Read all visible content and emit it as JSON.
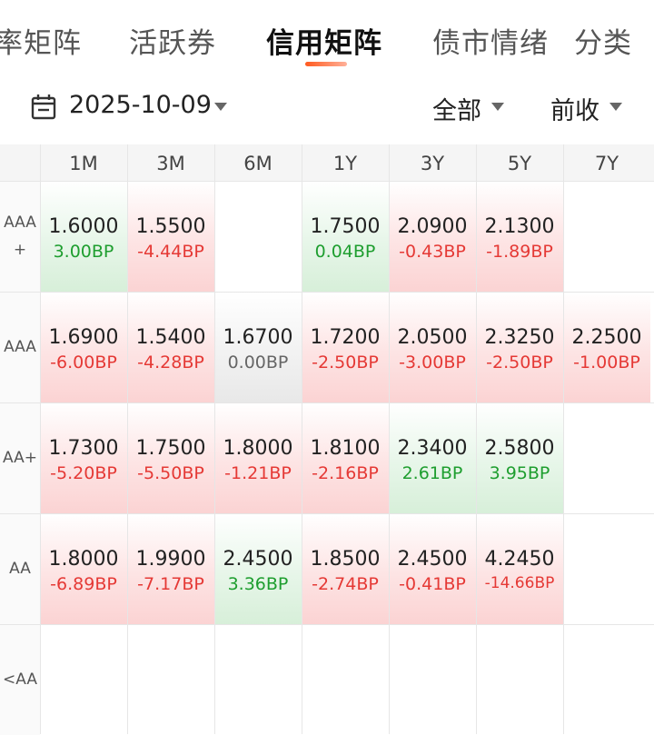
{
  "tabs": [
    {
      "label": "率矩阵"
    },
    {
      "label": "活跃券"
    },
    {
      "label": "信用矩阵"
    },
    {
      "label": "债市情绪"
    },
    {
      "label": "分类"
    }
  ],
  "filters": {
    "date": "2025-10-09",
    "scope": "全部",
    "price_basis": "前收"
  },
  "matrix": {
    "columns": [
      "1M",
      "3M",
      "6M",
      "1Y",
      "3Y",
      "5Y",
      "7Y"
    ],
    "rows": [
      {
        "label": "AAA\n+",
        "cells": [
          {
            "rate": "1.6000",
            "chg": "3.00BP",
            "dir": "down"
          },
          {
            "rate": "1.5500",
            "chg": "-4.44BP",
            "dir": "up"
          },
          null,
          {
            "rate": "1.7500",
            "chg": "0.04BP",
            "dir": "down"
          },
          {
            "rate": "2.0900",
            "chg": "-0.43BP",
            "dir": "up"
          },
          {
            "rate": "2.1300",
            "chg": "-1.89BP",
            "dir": "up"
          },
          null
        ]
      },
      {
        "label": "AAA",
        "cells": [
          {
            "rate": "1.6900",
            "chg": "-6.00BP",
            "dir": "up"
          },
          {
            "rate": "1.5400",
            "chg": "-4.28BP",
            "dir": "up"
          },
          {
            "rate": "1.6700",
            "chg": "0.00BP",
            "dir": "flat"
          },
          {
            "rate": "1.7200",
            "chg": "-2.50BP",
            "dir": "up"
          },
          {
            "rate": "2.0500",
            "chg": "-3.00BP",
            "dir": "up"
          },
          {
            "rate": "2.3250",
            "chg": "-2.50BP",
            "dir": "up"
          },
          {
            "rate": "2.2500",
            "chg": "-1.00BP",
            "dir": "up"
          }
        ]
      },
      {
        "label": "AA+",
        "cells": [
          {
            "rate": "1.7300",
            "chg": "-5.20BP",
            "dir": "up"
          },
          {
            "rate": "1.7500",
            "chg": "-5.50BP",
            "dir": "up"
          },
          {
            "rate": "1.8000",
            "chg": "-1.21BP",
            "dir": "up"
          },
          {
            "rate": "1.8100",
            "chg": "-2.16BP",
            "dir": "up"
          },
          {
            "rate": "2.3400",
            "chg": "2.61BP",
            "dir": "down"
          },
          {
            "rate": "2.5800",
            "chg": "3.95BP",
            "dir": "down"
          },
          null
        ]
      },
      {
        "label": "AA",
        "cells": [
          {
            "rate": "1.8000",
            "chg": "-6.89BP",
            "dir": "up"
          },
          {
            "rate": "1.9900",
            "chg": "-7.17BP",
            "dir": "up"
          },
          {
            "rate": "2.4500",
            "chg": "3.36BP",
            "dir": "down"
          },
          {
            "rate": "1.8500",
            "chg": "-2.74BP",
            "dir": "up"
          },
          {
            "rate": "2.4500",
            "chg": "-0.41BP",
            "dir": "up"
          },
          {
            "rate": "4.2450",
            "chg": "-14.66BP",
            "dir": "up"
          },
          null
        ]
      },
      {
        "label": "<AA",
        "cells": [
          null,
          null,
          null,
          null,
          null,
          null,
          null
        ]
      }
    ]
  },
  "colors": {
    "rise": "#e53935",
    "fall": "#1e9e2f",
    "accent": "#ff5a1f"
  },
  "icons": {
    "date": "calendar-icon",
    "dropdown": "chevron-down-icon"
  }
}
